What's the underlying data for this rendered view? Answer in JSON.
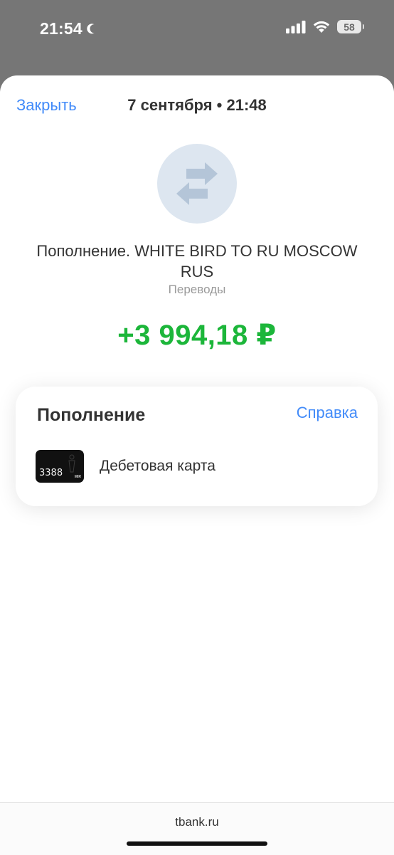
{
  "status_bar": {
    "time": "21:54",
    "battery": "58",
    "icons": [
      "moon-icon",
      "cellular-signal-icon",
      "wifi-icon",
      "battery-icon"
    ]
  },
  "sheet": {
    "close_label": "Закрыть",
    "title": "7 сентября • 21:48"
  },
  "operation": {
    "icon": "transfer-arrows-icon",
    "icon_background": "#dde6f0",
    "icon_color": "#b4c5d8",
    "merchant": "Пополнение. WHITE BIRD TO RU MOSCOW RUS",
    "category": "Переводы",
    "amount": "+3 994,18 ₽",
    "amount_color": "#1cb63a"
  },
  "details": {
    "heading": "Пополнение",
    "help_label": "Справка",
    "card_last4": "3388",
    "card_brand": "MIR",
    "account_label": "Дебетовая карта"
  },
  "browser": {
    "url": "tbank.ru"
  },
  "colors": {
    "link": "#428bf9",
    "text": "#333333",
    "secondary": "#9a9a9a"
  }
}
